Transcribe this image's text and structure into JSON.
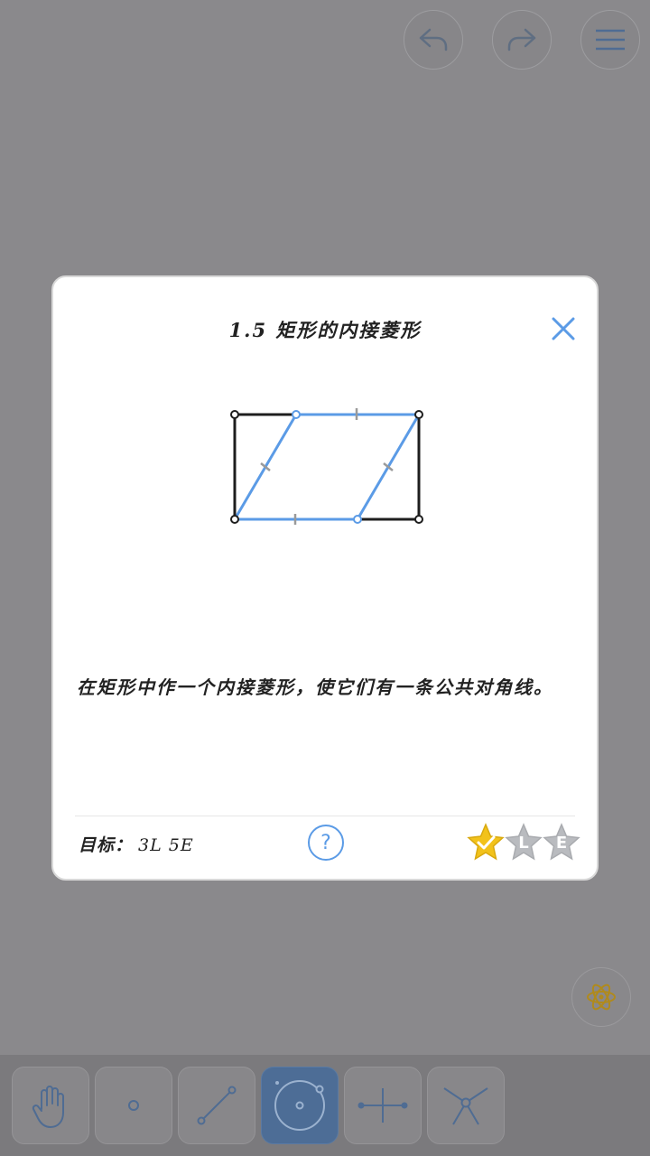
{
  "header": {
    "undo_icon": "undo-icon",
    "redo_icon": "redo-icon",
    "menu_icon": "hamburger-menu-icon"
  },
  "modal": {
    "title": "1.5 矩形的内接菱形",
    "close_icon": "close-icon",
    "description": "在矩形中作一个内接菱形，使它们有一条公共对角线。",
    "goal_label": "目标：",
    "goal_value": "3L 5E",
    "help_label": "?",
    "stars": [
      {
        "kind": "completed",
        "label": "",
        "color": "#f2c21b"
      },
      {
        "kind": "L",
        "label": "L",
        "color": "#b9bbbf"
      },
      {
        "kind": "E",
        "label": "E",
        "color": "#b9bbbf"
      }
    ]
  },
  "colors": {
    "accent": "#5b9be6",
    "overlay": "#8a898c",
    "star_gold": "#f2c21b"
  },
  "tools": [
    {
      "name": "hand-tool",
      "icon": "hand-icon"
    },
    {
      "name": "point-tool",
      "icon": "point-icon"
    },
    {
      "name": "line-tool",
      "icon": "line-segment-icon"
    },
    {
      "name": "circle-tool",
      "icon": "circle-icon",
      "active": true
    },
    {
      "name": "perpendicular-tool",
      "icon": "perpendicular-bisector-icon"
    },
    {
      "name": "intersect-tool",
      "icon": "angle-bisector-icon"
    }
  ],
  "floating": {
    "icon": "atom-icon"
  }
}
